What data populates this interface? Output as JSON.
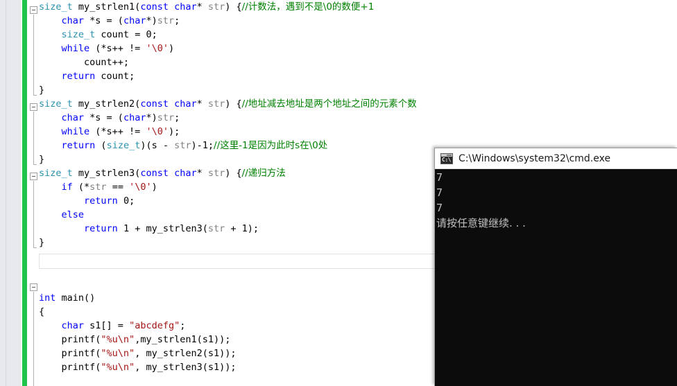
{
  "editor": {
    "change_bar_color": "#1fc44b",
    "gutter_color": "#e7e9ec",
    "code_lines": [
      {
        "indent": 0,
        "tokens": [
          {
            "t": "size_t",
            "c": "type"
          },
          {
            "t": " my_strlen1(",
            "c": "pun"
          },
          {
            "t": "const",
            "c": "kw"
          },
          {
            "t": " ",
            "c": "pun"
          },
          {
            "t": "char",
            "c": "kw"
          },
          {
            "t": "* ",
            "c": "pun"
          },
          {
            "t": "str",
            "c": "param"
          },
          {
            "t": ") {",
            "c": "pun"
          },
          {
            "t": "//计数法，遇到不是\\0的数便+1",
            "c": "cmt"
          }
        ]
      },
      {
        "indent": 1,
        "tokens": [
          {
            "t": "char",
            "c": "kw"
          },
          {
            "t": " *s = (",
            "c": "pun"
          },
          {
            "t": "char",
            "c": "kw"
          },
          {
            "t": "*)",
            "c": "pun"
          },
          {
            "t": "str",
            "c": "param"
          },
          {
            "t": ";",
            "c": "pun"
          }
        ]
      },
      {
        "indent": 1,
        "tokens": [
          {
            "t": "size_t",
            "c": "type"
          },
          {
            "t": " count = 0;",
            "c": "pun"
          }
        ]
      },
      {
        "indent": 1,
        "tokens": [
          {
            "t": "while",
            "c": "kw"
          },
          {
            "t": " (*s++ != ",
            "c": "pun"
          },
          {
            "t": "'\\0'",
            "c": "str"
          },
          {
            "t": ")",
            "c": "pun"
          }
        ]
      },
      {
        "indent": 2,
        "tokens": [
          {
            "t": "count++;",
            "c": "pun"
          }
        ]
      },
      {
        "indent": 1,
        "tokens": [
          {
            "t": "return",
            "c": "kw"
          },
          {
            "t": " count;",
            "c": "pun"
          }
        ]
      },
      {
        "indent": 0,
        "tokens": [
          {
            "t": "}",
            "c": "pun"
          }
        ]
      },
      {
        "indent": 0,
        "tokens": [
          {
            "t": "size_t",
            "c": "type"
          },
          {
            "t": " my_strlen2(",
            "c": "pun"
          },
          {
            "t": "const",
            "c": "kw"
          },
          {
            "t": " ",
            "c": "pun"
          },
          {
            "t": "char",
            "c": "kw"
          },
          {
            "t": "* ",
            "c": "pun"
          },
          {
            "t": "str",
            "c": "param"
          },
          {
            "t": ") {",
            "c": "pun"
          },
          {
            "t": "//地址减去地址是两个地址之间的元素个数",
            "c": "cmt"
          }
        ]
      },
      {
        "indent": 1,
        "tokens": [
          {
            "t": "char",
            "c": "kw"
          },
          {
            "t": " *s = (",
            "c": "pun"
          },
          {
            "t": "char",
            "c": "kw"
          },
          {
            "t": "*)",
            "c": "pun"
          },
          {
            "t": "str",
            "c": "param"
          },
          {
            "t": ";",
            "c": "pun"
          }
        ]
      },
      {
        "indent": 1,
        "tokens": [
          {
            "t": "while",
            "c": "kw"
          },
          {
            "t": " (*s++ != ",
            "c": "pun"
          },
          {
            "t": "'\\0'",
            "c": "str"
          },
          {
            "t": ");",
            "c": "pun"
          }
        ]
      },
      {
        "indent": 1,
        "tokens": [
          {
            "t": "return",
            "c": "kw"
          },
          {
            "t": " (",
            "c": "pun"
          },
          {
            "t": "size_t",
            "c": "type"
          },
          {
            "t": ")(s - ",
            "c": "pun"
          },
          {
            "t": "str",
            "c": "param"
          },
          {
            "t": ")-1;",
            "c": "pun"
          },
          {
            "t": "//这里-1是因为此时s在\\0处",
            "c": "cmt"
          }
        ]
      },
      {
        "indent": 0,
        "tokens": [
          {
            "t": "}",
            "c": "pun"
          }
        ]
      },
      {
        "indent": 0,
        "tokens": [
          {
            "t": "size_t",
            "c": "type"
          },
          {
            "t": " my_strlen3(",
            "c": "pun"
          },
          {
            "t": "const",
            "c": "kw"
          },
          {
            "t": " ",
            "c": "pun"
          },
          {
            "t": "char",
            "c": "kw"
          },
          {
            "t": "* ",
            "c": "pun"
          },
          {
            "t": "str",
            "c": "param"
          },
          {
            "t": ") {",
            "c": "pun"
          },
          {
            "t": "//递归方法",
            "c": "cmt"
          }
        ]
      },
      {
        "indent": 1,
        "tokens": [
          {
            "t": "if",
            "c": "kw"
          },
          {
            "t": " (*",
            "c": "pun"
          },
          {
            "t": "str",
            "c": "param"
          },
          {
            "t": " == ",
            "c": "pun"
          },
          {
            "t": "'\\0'",
            "c": "str"
          },
          {
            "t": ")",
            "c": "pun"
          }
        ]
      },
      {
        "indent": 2,
        "tokens": [
          {
            "t": "return",
            "c": "kw"
          },
          {
            "t": " 0;",
            "c": "pun"
          }
        ]
      },
      {
        "indent": 1,
        "tokens": [
          {
            "t": "else",
            "c": "kw"
          }
        ]
      },
      {
        "indent": 2,
        "tokens": [
          {
            "t": "return",
            "c": "kw"
          },
          {
            "t": " 1 + my_strlen3(",
            "c": "pun"
          },
          {
            "t": "str",
            "c": "param"
          },
          {
            "t": " + 1);",
            "c": "pun"
          }
        ]
      },
      {
        "indent": 0,
        "tokens": [
          {
            "t": "}",
            "c": "pun"
          }
        ]
      },
      {
        "indent": 0,
        "tokens": []
      },
      {
        "indent": 0,
        "tokens": []
      },
      {
        "indent": 0,
        "tokens": []
      },
      {
        "indent": 0,
        "tokens": [
          {
            "t": "int",
            "c": "kw"
          },
          {
            "t": " main()",
            "c": "pun"
          }
        ]
      },
      {
        "indent": 0,
        "tokens": [
          {
            "t": "{",
            "c": "pun"
          }
        ]
      },
      {
        "indent": 1,
        "tokens": [
          {
            "t": "char",
            "c": "kw"
          },
          {
            "t": " s1[] = ",
            "c": "pun"
          },
          {
            "t": "\"abcdefg\"",
            "c": "str"
          },
          {
            "t": ";",
            "c": "pun"
          }
        ]
      },
      {
        "indent": 1,
        "tokens": [
          {
            "t": "printf(",
            "c": "pun"
          },
          {
            "t": "\"%u\\n\"",
            "c": "str"
          },
          {
            "t": ",my_strlen1(s1));",
            "c": "pun"
          }
        ]
      },
      {
        "indent": 1,
        "tokens": [
          {
            "t": "printf(",
            "c": "pun"
          },
          {
            "t": "\"%u\\n\"",
            "c": "str"
          },
          {
            "t": ", my_strlen2(s1));",
            "c": "pun"
          }
        ]
      },
      {
        "indent": 1,
        "tokens": [
          {
            "t": "printf(",
            "c": "pun"
          },
          {
            "t": "\"%u\\n\"",
            "c": "str"
          },
          {
            "t": ", my_strlen3(s1));",
            "c": "pun"
          }
        ]
      }
    ]
  },
  "console": {
    "title": "C:\\Windows\\system32\\cmd.exe",
    "icon": "cmd-icon",
    "icon_prompt": "C:\\",
    "output_lines": [
      "7",
      "7",
      "7",
      "请按任意键继续. . ."
    ]
  }
}
